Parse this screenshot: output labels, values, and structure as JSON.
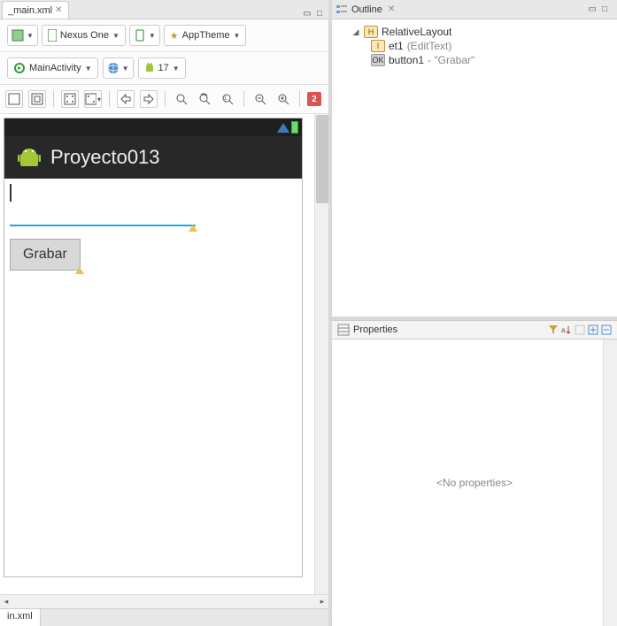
{
  "editor": {
    "tab_name": "_main.xml",
    "bottom_tab": "in.xml"
  },
  "toolbar": {
    "device": "Nexus One",
    "theme": "AppTheme",
    "activity": "MainActivity",
    "api": "17",
    "error_count": "2"
  },
  "preview": {
    "app_name": "Proyecto013",
    "button_label": "Grabar"
  },
  "outline": {
    "title": "Outline",
    "root": "RelativeLayout",
    "children": [
      {
        "id": "et1",
        "class": "(EditText)"
      },
      {
        "id": "button1",
        "text": "- \"Grabar\""
      }
    ]
  },
  "properties": {
    "title": "Properties",
    "empty": "<No properties>"
  }
}
